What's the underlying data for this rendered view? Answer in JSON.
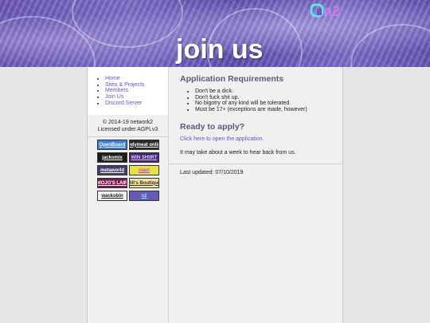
{
  "banner": {
    "title": "join us",
    "logo_text": "n2"
  },
  "nav": {
    "items": [
      "Home",
      "Sites & Projects",
      "Members",
      "Join Us",
      "Discord Server"
    ]
  },
  "footer": {
    "copyright": "© 2014-19 network2",
    "license": "Licensed under AGPLv3"
  },
  "badges": [
    {
      "label": "OpenBoard",
      "bg": "#3b7fd0",
      "fg": "#ffffff"
    },
    {
      "label": "Endymeat online",
      "bg": "#2a2a2a",
      "fg": "#ffffff"
    },
    {
      "label": "jackomix",
      "bg": "#1c1c1c",
      "fg": "#ffffff"
    },
    {
      "label": "WIN SHIIRT",
      "bg": "#3a2670",
      "fg": "#f5c6ff"
    },
    {
      "label": "metaworld",
      "bg": "#463a6a",
      "fg": "#ffffff"
    },
    {
      "label": "ciao!",
      "bg": "#e8e04a",
      "fg": "#c23ad8"
    },
    {
      "label": "MOJO'S LAIR",
      "bg": "#7a1a4a",
      "fg": "#ffffff"
    },
    {
      "label": "Jill's Boutique",
      "bg": "#f4e2a0",
      "fg": "#333333"
    },
    {
      "label": "wackobin",
      "bg": "#f0f0f0",
      "fg": "#222222"
    },
    {
      "label": "n2",
      "bg": "#6a58b8",
      "fg": "#7df0e8"
    }
  ],
  "main": {
    "requirements_heading": "Application Requirements",
    "requirements": [
      "Don't be a dick.",
      "Don't fuck shit up.",
      "No bigotry of any kind will be tolerated.",
      "Must be 17+ (exceptions are made, however)"
    ],
    "apply_heading": "Ready to apply?",
    "apply_link": "Click here to open the application.",
    "wait_text": "It may take about a week to hear back from us.",
    "last_updated": "Last updated: 07/10/2019"
  },
  "colors": {
    "accent": "#6a4fc8",
    "banner": "#6a57b8",
    "logo_cyan": "#5fe6e0"
  }
}
